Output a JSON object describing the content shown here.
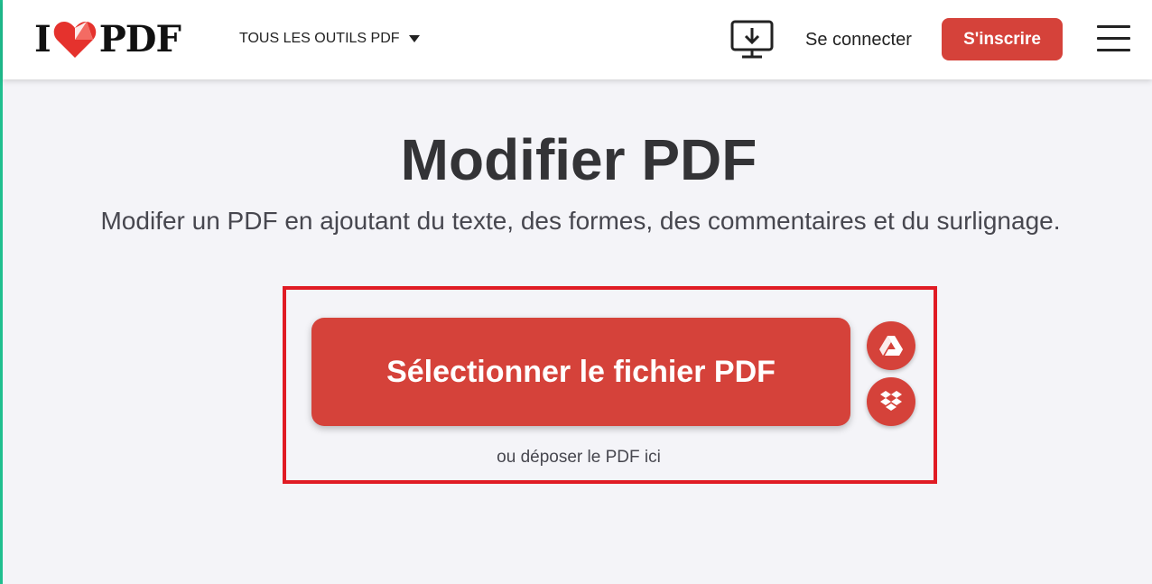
{
  "header": {
    "logo": {
      "letter_left": "I",
      "letter_right": "PDF"
    },
    "tools_menu_label": "TOUS LES OUTILS PDF",
    "desktop_icon": "desktop-download-icon",
    "login_label": "Se connecter",
    "signup_label": "S'inscrire",
    "menu_icon": "hamburger-menu-icon"
  },
  "main": {
    "title": "Modifier PDF",
    "subtitle": "Modifer un PDF en ajoutant du texte, des formes, des commentaires et du surlignage.",
    "select_button_label": "Sélectionner le fichier PDF",
    "cloud_buttons": [
      {
        "icon": "google-drive-icon"
      },
      {
        "icon": "dropbox-icon"
      }
    ],
    "drop_hint": "ou déposer le PDF ici"
  },
  "colors": {
    "brand_red": "#d5423a",
    "highlight_red": "#e01b24",
    "background": "#f4f4f8",
    "accent_green": "#1fbf8f"
  }
}
